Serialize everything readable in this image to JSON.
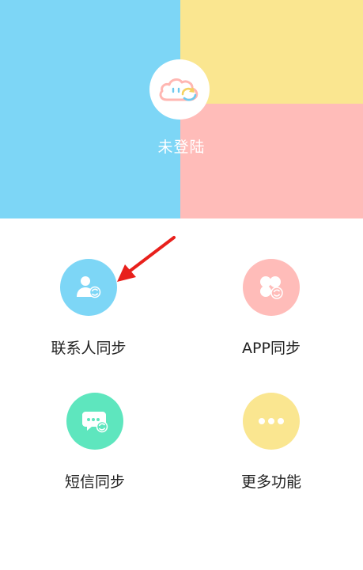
{
  "header": {
    "login_status": "未登陆",
    "colors": {
      "blue": "#7dd6f6",
      "yellow": "#fae690",
      "pink": "#ffbcb9"
    },
    "avatar_icon": "cloud-sync-icon"
  },
  "features": [
    {
      "label": "联系人同步",
      "icon": "contact-sync-icon",
      "color": "#7dd6f6"
    },
    {
      "label": "APP同步",
      "icon": "app-sync-icon",
      "color": "#ffbcb9"
    },
    {
      "label": "短信同步",
      "icon": "message-sync-icon",
      "color": "#5ee6be"
    },
    {
      "label": "更多功能",
      "icon": "more-icon",
      "color": "#fae690"
    }
  ],
  "annotation": {
    "arrow_color": "#e8201c"
  }
}
